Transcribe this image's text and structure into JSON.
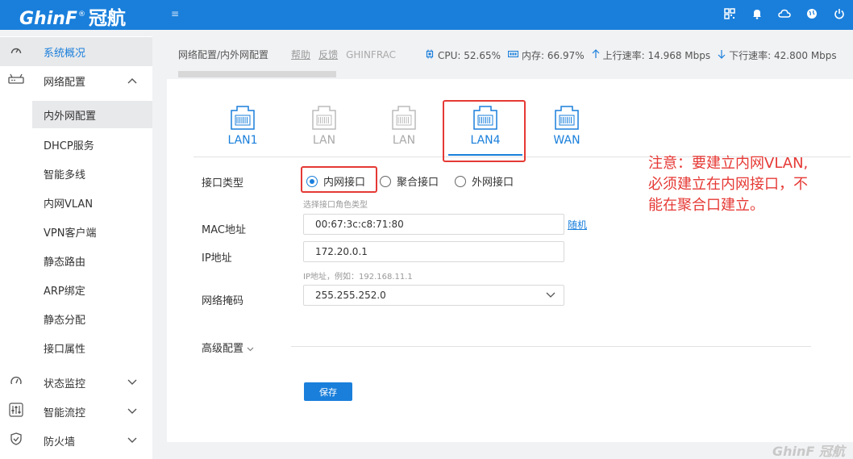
{
  "header": {
    "logo_text": "GhinF",
    "logo_reg": "®",
    "logo_cn": "冠航",
    "menu_glyph": "≡",
    "icons": [
      "qrcode-icon",
      "bell-icon",
      "cloud-icon",
      "globe-icon",
      "power-icon"
    ]
  },
  "sidebar": {
    "items": [
      {
        "label": "系统概况",
        "icon": "dashboard-icon"
      },
      {
        "label": "网络配置",
        "icon": "router-icon"
      },
      {
        "label": "状态监控",
        "icon": "monitor-icon"
      },
      {
        "label": "智能流控",
        "icon": "sliders-icon"
      },
      {
        "label": "防火墙",
        "icon": "shield-icon"
      }
    ],
    "subitems": [
      "内外网配置",
      "DHCP服务",
      "智能多线",
      "内网VLAN",
      "VPN客户端",
      "静态路由",
      "ARP绑定",
      "静态分配",
      "接口属性"
    ]
  },
  "breadcrumb": {
    "path": "网络配置/内外网配置",
    "help": "帮助",
    "feedback": "反馈",
    "brand": "GHINFRAC"
  },
  "stats": {
    "cpu": "CPU: 52.65%",
    "mem": "内存: 66.97%",
    "up": "上行速率: 14.968 Mbps",
    "down": "下行速率: 42.800 Mbps"
  },
  "ports": [
    {
      "label": "LAN1",
      "state": "blue"
    },
    {
      "label": "LAN",
      "state": "gray"
    },
    {
      "label": "LAN",
      "state": "gray"
    },
    {
      "label": "LAN4",
      "state": "active"
    },
    {
      "label": "WAN",
      "state": "blue"
    }
  ],
  "form": {
    "iface_type_label": "接口类型",
    "radio_options": [
      "内网接口",
      "聚合接口",
      "外网接口"
    ],
    "radio_selected": "内网接口",
    "iface_hint": "选择接口角色类型",
    "mac_label": "MAC地址",
    "mac_value": "00:67:3c:c8:71:80",
    "random_link": "随机",
    "ip_label": "IP地址",
    "ip_value": "172.20.0.1",
    "ip_hint": "IP地址，例如：192.168.11.1",
    "mask_label": "网络掩码",
    "mask_value": "255.255.252.0",
    "advanced_label": "高级配置",
    "save_label": "保存"
  },
  "annotation": {
    "line1": "注意：要建立内网VLAN,",
    "line2": "必须建立在内网接口，不",
    "line3": "能在聚合口建立。",
    "color": "#e53935"
  },
  "watermark": "GhinF 冠航",
  "colors": {
    "accent": "#1a7fdb",
    "highlight": "#e53935"
  }
}
